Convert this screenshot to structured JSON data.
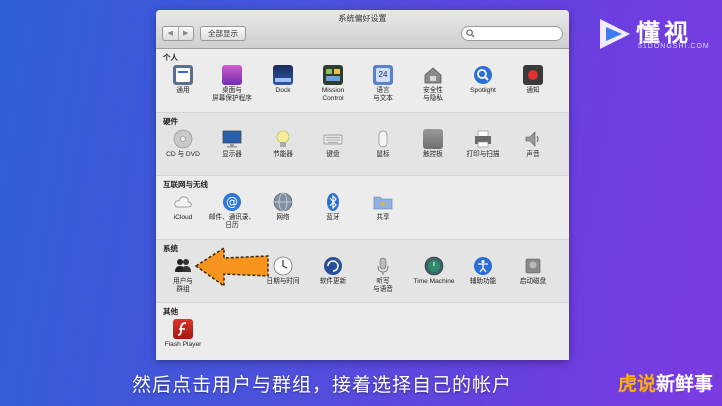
{
  "watermark": {
    "name": "懂视",
    "sub": "51DONGSHI.COM"
  },
  "window": {
    "title": "系统偏好设置",
    "nav_back": "◀",
    "nav_forward": "▶",
    "show_all": "全部显示",
    "search_placeholder": ""
  },
  "sections": {
    "personal": {
      "label": "个人",
      "items": [
        "通用",
        "桌面与\n屏幕保护程序",
        "Dock",
        "Mission\nControl",
        "语言\n与文本",
        "安全性\n与隐私",
        "Spotlight",
        "通知"
      ]
    },
    "hardware": {
      "label": "硬件",
      "items": [
        "CD 与 DVD",
        "显示器",
        "节能器",
        "键盘",
        "鼠标",
        "触控板",
        "打印与扫描",
        "声音"
      ]
    },
    "internet": {
      "label": "互联网与无线",
      "items": [
        "iCloud",
        "邮件、通讯录、\n日历",
        "网络",
        "蓝牙",
        "共享"
      ]
    },
    "system": {
      "label": "系统",
      "items": [
        "用户与\n群组",
        "日期与时间",
        "软件更新",
        "听写\n与语音",
        "Time Machine",
        "辅助功能",
        "启动磁盘"
      ]
    },
    "other": {
      "label": "其他",
      "items": [
        "Flash Player"
      ]
    }
  },
  "caption": "然后点击用户与群组，接着选择自己的帐户",
  "brand": {
    "part1": "虎说",
    "part2": "新鲜事"
  },
  "colors": {
    "accent_arrow": "#f7941d",
    "bg_left": "#2f5fd8",
    "bg_right": "#7b3be0"
  }
}
